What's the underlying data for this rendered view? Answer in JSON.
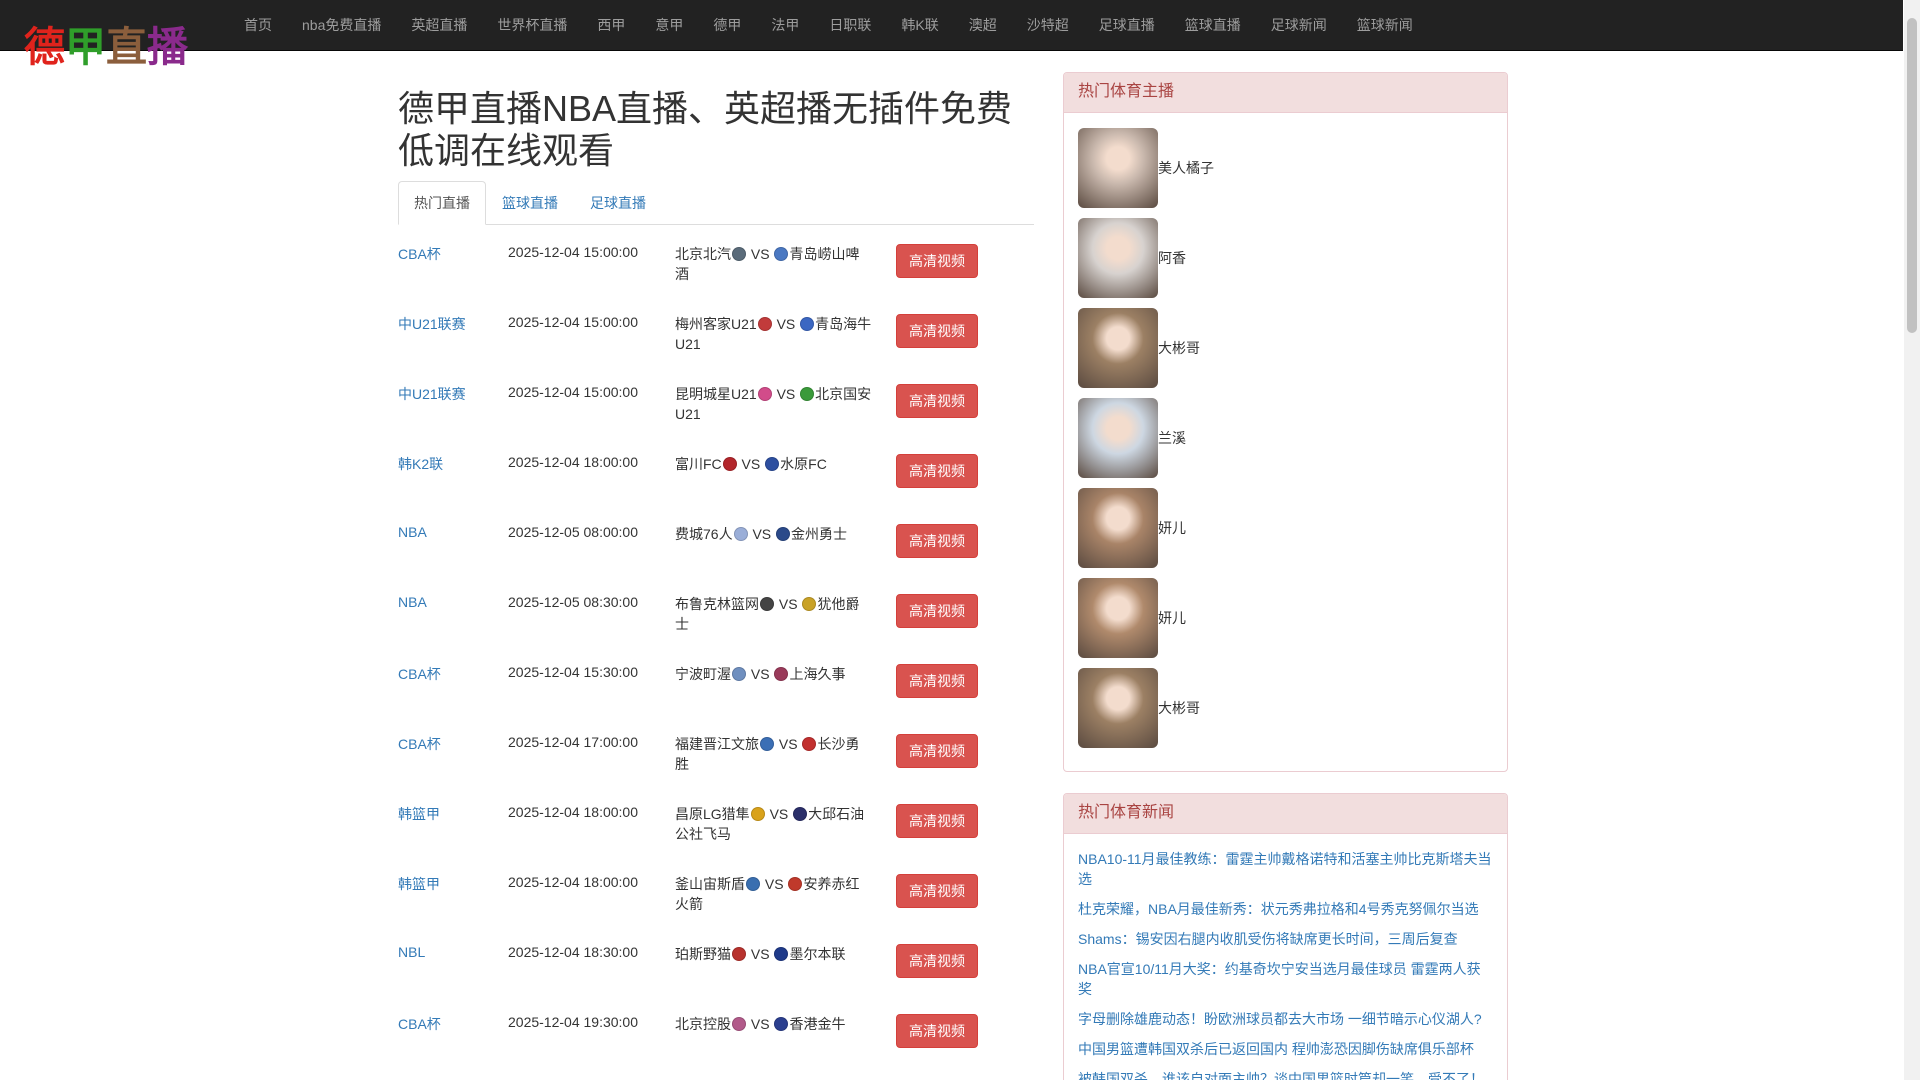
{
  "brand": {
    "logo_chars": [
      {
        "ch": "德",
        "color": "#e0231c"
      },
      {
        "ch": "甲",
        "color": "#2f9e2a"
      },
      {
        "ch": "直",
        "color": "#8b5e3c"
      },
      {
        "ch": "播",
        "color": "#8a2a8c"
      }
    ]
  },
  "nav": {
    "items": [
      "首页",
      "nba免费直播",
      "英超直播",
      "世界杯直播",
      "西甲",
      "意甲",
      "德甲",
      "法甲",
      "日职联",
      "韩K联",
      "澳超",
      "沙特超",
      "足球直播",
      "篮球直播",
      "足球新闻",
      "篮球新闻"
    ]
  },
  "main": {
    "title": "德甲直播NBA直播、英超播无插件免费低调在线观看",
    "tabs": [
      "热门直播",
      "篮球直播",
      "足球直播"
    ],
    "watch_label": "高清视频",
    "vs": "VS",
    "matches": [
      {
        "league": "CBA杯",
        "time": "2025-12-04 15:00:00",
        "home": "北京北汽",
        "away": "青岛崂山啤酒",
        "home_color": "#5a6b7a",
        "away_color": "#4a78c2"
      },
      {
        "league": "中U21联赛",
        "time": "2025-12-04 15:00:00",
        "home": "梅州客家U21",
        "away": "青岛海牛U21",
        "home_color": "#c23b3b",
        "away_color": "#3b67c2"
      },
      {
        "league": "中U21联赛",
        "time": "2025-12-04 15:00:00",
        "home": "昆明城星U21",
        "away": "北京国安U21",
        "home_color": "#d24c8a",
        "away_color": "#3a9a3a"
      },
      {
        "league": "韩K2联",
        "time": "2025-12-04 18:00:00",
        "home": "富川FC",
        "away": "水原FC",
        "home_color": "#b3262b",
        "away_color": "#2d4fa0"
      },
      {
        "league": "NBA",
        "time": "2025-12-05 08:00:00",
        "home": "费城76人",
        "away": "金州勇士",
        "home_color": "#9aaed8",
        "away_color": "#2b4a8a"
      },
      {
        "league": "NBA",
        "time": "2025-12-05 08:30:00",
        "home": "布鲁克林篮网",
        "away": "犹他爵士",
        "home_color": "#444444",
        "away_color": "#c9a227"
      },
      {
        "league": "CBA杯",
        "time": "2025-12-04 15:30:00",
        "home": "宁波町渥",
        "away": "上海久事",
        "home_color": "#6f8fbf",
        "away_color": "#9a3a5a"
      },
      {
        "league": "CBA杯",
        "time": "2025-12-04 17:00:00",
        "home": "福建晋江文旅",
        "away": "长沙勇胜",
        "home_color": "#3b6fb5",
        "away_color": "#c2302f"
      },
      {
        "league": "韩篮甲",
        "time": "2025-12-04 18:00:00",
        "home": "昌原LG猎隼",
        "away": "大邱石油公社飞马",
        "home_color": "#d9a21b",
        "away_color": "#2b2f6a"
      },
      {
        "league": "韩篮甲",
        "time": "2025-12-04 18:00:00",
        "home": "釜山宙斯盾",
        "away": "安养赤红火箭",
        "home_color": "#3a6fb0",
        "away_color": "#c0392b"
      },
      {
        "league": "NBL",
        "time": "2025-12-04 18:30:00",
        "home": "珀斯野猫",
        "away": "墨尔本联",
        "home_color": "#b8322d",
        "away_color": "#1f3a8a"
      },
      {
        "league": "CBA杯",
        "time": "2025-12-04 19:30:00",
        "home": "北京控股",
        "away": "香港金牛",
        "home_color": "#b25a8a",
        "away_color": "#2b3f8f"
      }
    ]
  },
  "sidebar": {
    "anchors_title": "热门体育主播",
    "anchors": [
      {
        "name": "美人橘子",
        "tone": "#c9b8ad"
      },
      {
        "name": "阿香",
        "tone": "#d7d2cf"
      },
      {
        "name": "大彬哥",
        "tone": "#9c8064"
      },
      {
        "name": "兰溪",
        "tone": "#cdd7e2"
      },
      {
        "name": "妍儿",
        "tone": "#a98468"
      },
      {
        "name": "妍儿",
        "tone": "#b08a6c"
      },
      {
        "name": "大彬哥",
        "tone": "#9c8064"
      }
    ],
    "news_title": "热门体育新闻",
    "news": [
      "NBA10-11月最佳教练：雷霆主帅戴格诺特和活塞主帅比克斯塔夫当选",
      "杜克荣耀，NBA月最佳新秀：状元秀弗拉格和4号秀克努佩尔当选",
      "Shams：锡安因右腿内收肌受伤将缺席更长时间，三周后复查",
      "NBA官宣10/11月大奖：约基奇坎宁安当选月最佳球员 雷霆两人获奖",
      "字母删除雄鹿动态！盼欧洲球员都去大市场 一细节暗示心仪湖人?",
      "中国男篮遭韩国双杀后已返回国内 程帅澎恐因脚伤缺席俱乐部杯",
      "被韩国双杀，谁该自对面主帅？谈中国男篮时篇却一笑，受不了！"
    ]
  }
}
